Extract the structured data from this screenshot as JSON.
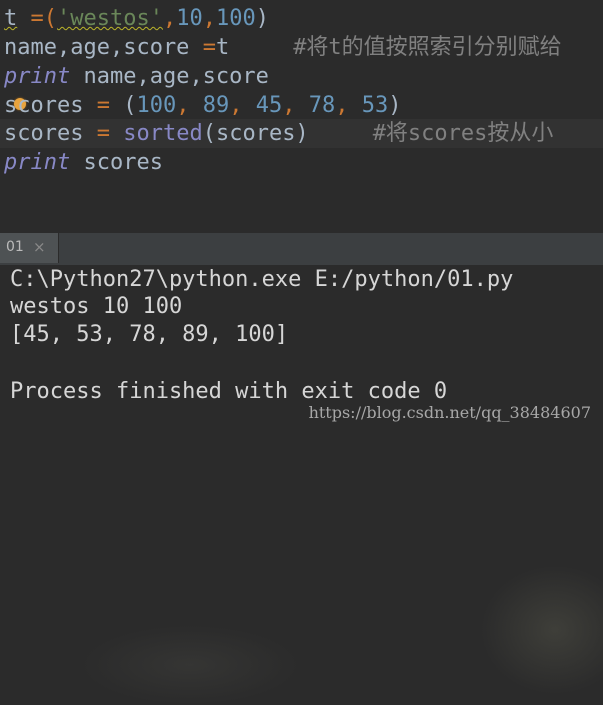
{
  "editor": {
    "l1": {
      "t": "t",
      "op": " =(",
      "s": "'westos'",
      "c1": ",",
      "n1": "10",
      "c2": ",",
      "n2": "100",
      "close": ")"
    },
    "l2": {
      "text": "name,age,score ",
      "op": "=",
      "rest": "t",
      "comment": "#将t的值按照索引分别赋给"
    },
    "l3": {
      "kw": "print",
      "rest": " name,age,score"
    },
    "l4": {
      "var": "scores",
      "op": " = ",
      "open": "(",
      "n1": "100",
      "s1": ", ",
      "n2": "89",
      "s2": ", ",
      "n3": "45",
      "s3": ", ",
      "n4": "78",
      "s4": ", ",
      "n5": "53",
      "close": ")"
    },
    "l5": {
      "var": "scores",
      "op": " = ",
      "fn": "sorted",
      "args": "(scores)",
      "comment": "#将scores按从小"
    },
    "l6": {
      "kw": "print",
      "rest": " scores"
    }
  },
  "run_tab": {
    "label": "01",
    "close_glyph": "×"
  },
  "console": {
    "line1": "C:\\Python27\\python.exe E:/python/01.py",
    "line2": "westos 10 100",
    "line3": "[45, 53, 78, 89, 100]",
    "line4": "",
    "line5": "Process finished with exit code 0"
  },
  "watermark": "https://blog.csdn.net/qq_38484607",
  "colors": {
    "background": "#2b2b2b",
    "keyword": "#cc7832",
    "string": "#6a8759",
    "number": "#6897bb",
    "builtin": "#8888c6",
    "comment": "#808080"
  }
}
